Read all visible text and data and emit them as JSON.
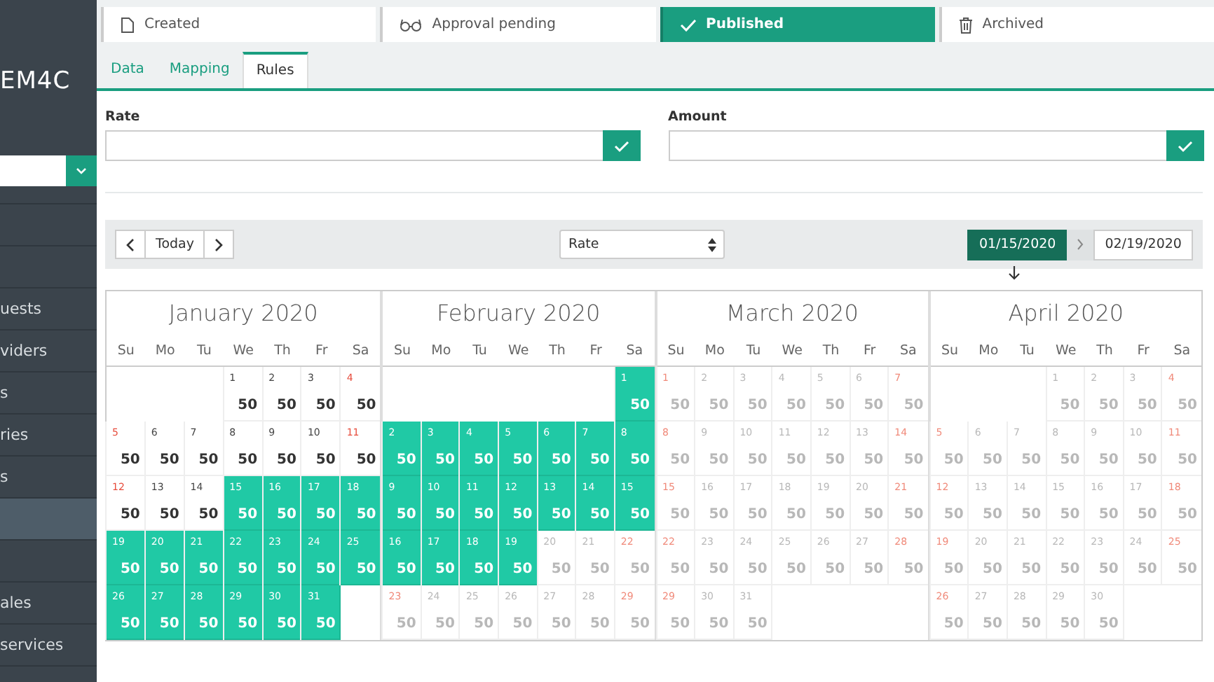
{
  "sidebar": {
    "logo": "EM4C",
    "items": [
      {
        "selected": false
      },
      {
        "selected": false
      },
      {
        "label": "uests",
        "selected": false
      },
      {
        "label": "viders",
        "selected": false
      },
      {
        "label": "s",
        "selected": false
      },
      {
        "label": "ries",
        "selected": false
      },
      {
        "label": "s",
        "selected": false
      },
      {
        "selected": true
      },
      {
        "selected": false
      },
      {
        "label": "ales",
        "selected": false
      },
      {
        "label": "services",
        "selected": false
      }
    ]
  },
  "steps": [
    {
      "label": "Created",
      "selected": false
    },
    {
      "label": "Approval pending",
      "selected": false
    },
    {
      "label": "Published",
      "selected": true
    },
    {
      "label": "Archived",
      "selected": false
    }
  ],
  "tabs": [
    {
      "label": "Data",
      "selected": false
    },
    {
      "label": "Mapping",
      "selected": false
    },
    {
      "label": "Rules",
      "selected": true
    }
  ],
  "fields": [
    {
      "label": "Rate"
    },
    {
      "label": "Amount"
    }
  ],
  "toolbar": {
    "today": "Today",
    "select": "Rate",
    "range": [
      {
        "label": "01/15/2020",
        "selected": true
      },
      {
        "label": "02/19/2020",
        "selected": false
      }
    ]
  },
  "months": [
    {
      "title": "January 2020",
      "weekdays": [
        "Su",
        "Mo",
        "Tu",
        "We",
        "Th",
        "Fr",
        "Sa"
      ],
      "weeks": [
        [
          {
            "day": "1",
            "value": "50",
            "kind": "past"
          },
          {
            "day": "2",
            "value": "50",
            "kind": "past"
          },
          {
            "day": "3",
            "value": "50",
            "kind": "past"
          },
          {
            "day": "4",
            "value": "50",
            "kind": "past"
          }
        ],
        [
          {
            "day": "5",
            "value": "50",
            "kind": "past"
          },
          {
            "day": "6",
            "value": "50",
            "kind": "past"
          },
          {
            "day": "7",
            "value": "50",
            "kind": "past"
          },
          {
            "day": "8",
            "value": "50",
            "kind": "past"
          },
          {
            "day": "9",
            "value": "50",
            "kind": "past"
          },
          {
            "day": "10",
            "value": "50",
            "kind": "past"
          },
          {
            "day": "11",
            "value": "50",
            "kind": "past"
          }
        ],
        [
          {
            "day": "12",
            "value": "50",
            "kind": "past"
          },
          {
            "day": "13",
            "value": "50",
            "kind": "past"
          },
          {
            "day": "14",
            "value": "50",
            "kind": "past"
          },
          {
            "day": "15",
            "value": "50",
            "kind": "selected"
          },
          {
            "day": "16",
            "value": "50",
            "kind": "selected"
          },
          {
            "day": "17",
            "value": "50",
            "kind": "selected"
          },
          {
            "day": "18",
            "value": "50",
            "kind": "selected"
          }
        ],
        [
          {
            "day": "19",
            "value": "50",
            "kind": "selected"
          },
          {
            "day": "20",
            "value": "50",
            "kind": "selected"
          },
          {
            "day": "21",
            "value": "50",
            "kind": "selected"
          },
          {
            "day": "22",
            "value": "50",
            "kind": "selected"
          },
          {
            "day": "23",
            "value": "50",
            "kind": "selected"
          },
          {
            "day": "24",
            "value": "50",
            "kind": "selected"
          },
          {
            "day": "25",
            "value": "50",
            "kind": "selected"
          }
        ],
        [
          {
            "day": "26",
            "value": "50",
            "kind": "selected"
          },
          {
            "day": "27",
            "value": "50",
            "kind": "selected"
          },
          {
            "day": "28",
            "value": "50",
            "kind": "selected"
          },
          {
            "day": "29",
            "value": "50",
            "kind": "selected"
          },
          {
            "day": "30",
            "value": "50",
            "kind": "selected"
          },
          {
            "day": "31",
            "value": "50",
            "kind": "selected"
          }
        ]
      ]
    },
    {
      "title": "February 2020",
      "weekdays": [
        "Su",
        "Mo",
        "Tu",
        "We",
        "Th",
        "Fr",
        "Sa"
      ],
      "weeks": [
        [
          {
            "day": "1",
            "value": "50",
            "kind": "selected"
          }
        ],
        [
          {
            "day": "2",
            "value": "50",
            "kind": "selected"
          },
          {
            "day": "3",
            "value": "50",
            "kind": "selected"
          },
          {
            "day": "4",
            "value": "50",
            "kind": "selected"
          },
          {
            "day": "5",
            "value": "50",
            "kind": "selected"
          },
          {
            "day": "6",
            "value": "50",
            "kind": "selected"
          },
          {
            "day": "7",
            "value": "50",
            "kind": "selected"
          },
          {
            "day": "8",
            "value": "50",
            "kind": "selected"
          }
        ],
        [
          {
            "day": "9",
            "value": "50",
            "kind": "selected"
          },
          {
            "day": "10",
            "value": "50",
            "kind": "selected"
          },
          {
            "day": "11",
            "value": "50",
            "kind": "selected"
          },
          {
            "day": "12",
            "value": "50",
            "kind": "selected"
          },
          {
            "day": "13",
            "value": "50",
            "kind": "selected"
          },
          {
            "day": "14",
            "value": "50",
            "kind": "selected"
          },
          {
            "day": "15",
            "value": "50",
            "kind": "selected"
          }
        ],
        [
          {
            "day": "16",
            "value": "50",
            "kind": "selected"
          },
          {
            "day": "17",
            "value": "50",
            "kind": "selected"
          },
          {
            "day": "18",
            "value": "50",
            "kind": "selected"
          },
          {
            "day": "19",
            "value": "50",
            "kind": "selected"
          },
          {
            "day": "20",
            "value": "50",
            "kind": "future"
          },
          {
            "day": "21",
            "value": "50",
            "kind": "future"
          },
          {
            "day": "22",
            "value": "50",
            "kind": "future"
          }
        ],
        [
          {
            "day": "23",
            "value": "50",
            "kind": "future"
          },
          {
            "day": "24",
            "value": "50",
            "kind": "future"
          },
          {
            "day": "25",
            "value": "50",
            "kind": "future"
          },
          {
            "day": "26",
            "value": "50",
            "kind": "future"
          },
          {
            "day": "27",
            "value": "50",
            "kind": "future"
          },
          {
            "day": "28",
            "value": "50",
            "kind": "future"
          },
          {
            "day": "29",
            "value": "50",
            "kind": "future"
          }
        ]
      ]
    },
    {
      "title": "March 2020",
      "weekdays": [
        "Su",
        "Mo",
        "Tu",
        "We",
        "Th",
        "Fr",
        "Sa"
      ],
      "weeks": [
        [
          {
            "day": "1",
            "value": "50",
            "kind": "future"
          },
          {
            "day": "2",
            "value": "50",
            "kind": "future"
          },
          {
            "day": "3",
            "value": "50",
            "kind": "future"
          },
          {
            "day": "4",
            "value": "50",
            "kind": "future"
          },
          {
            "day": "5",
            "value": "50",
            "kind": "future"
          },
          {
            "day": "6",
            "value": "50",
            "kind": "future"
          },
          {
            "day": "7",
            "value": "50",
            "kind": "future"
          }
        ],
        [
          {
            "day": "8",
            "value": "50",
            "kind": "future"
          },
          {
            "day": "9",
            "value": "50",
            "kind": "future"
          },
          {
            "day": "10",
            "value": "50",
            "kind": "future"
          },
          {
            "day": "11",
            "value": "50",
            "kind": "future"
          },
          {
            "day": "12",
            "value": "50",
            "kind": "future"
          },
          {
            "day": "13",
            "value": "50",
            "kind": "future"
          },
          {
            "day": "14",
            "value": "50",
            "kind": "future"
          }
        ],
        [
          {
            "day": "15",
            "value": "50",
            "kind": "future"
          },
          {
            "day": "16",
            "value": "50",
            "kind": "future"
          },
          {
            "day": "17",
            "value": "50",
            "kind": "future"
          },
          {
            "day": "18",
            "value": "50",
            "kind": "future"
          },
          {
            "day": "19",
            "value": "50",
            "kind": "future"
          },
          {
            "day": "20",
            "value": "50",
            "kind": "future"
          },
          {
            "day": "21",
            "value": "50",
            "kind": "future"
          }
        ],
        [
          {
            "day": "22",
            "value": "50",
            "kind": "future"
          },
          {
            "day": "23",
            "value": "50",
            "kind": "future"
          },
          {
            "day": "24",
            "value": "50",
            "kind": "future"
          },
          {
            "day": "25",
            "value": "50",
            "kind": "future"
          },
          {
            "day": "26",
            "value": "50",
            "kind": "future"
          },
          {
            "day": "27",
            "value": "50",
            "kind": "future"
          },
          {
            "day": "28",
            "value": "50",
            "kind": "future"
          }
        ],
        [
          {
            "day": "29",
            "value": "50",
            "kind": "future"
          },
          {
            "day": "30",
            "value": "50",
            "kind": "future"
          },
          {
            "day": "31",
            "value": "50",
            "kind": "future"
          }
        ]
      ]
    },
    {
      "title": "April 2020",
      "weekdays": [
        "Su",
        "Mo",
        "Tu",
        "We",
        "Th",
        "Fr",
        "Sa"
      ],
      "weeks": [
        [
          {
            "day": "1",
            "value": "50",
            "kind": "future"
          },
          {
            "day": "2",
            "value": "50",
            "kind": "future"
          },
          {
            "day": "3",
            "value": "50",
            "kind": "future"
          },
          {
            "day": "4",
            "value": "50",
            "kind": "future"
          }
        ],
        [
          {
            "day": "5",
            "value": "50",
            "kind": "future"
          },
          {
            "day": "6",
            "value": "50",
            "kind": "future"
          },
          {
            "day": "7",
            "value": "50",
            "kind": "future"
          },
          {
            "day": "8",
            "value": "50",
            "kind": "future"
          },
          {
            "day": "9",
            "value": "50",
            "kind": "future"
          },
          {
            "day": "10",
            "value": "50",
            "kind": "future"
          },
          {
            "day": "11",
            "value": "50",
            "kind": "future"
          }
        ],
        [
          {
            "day": "12",
            "value": "50",
            "kind": "future"
          },
          {
            "day": "13",
            "value": "50",
            "kind": "future"
          },
          {
            "day": "14",
            "value": "50",
            "kind": "future"
          },
          {
            "day": "15",
            "value": "50",
            "kind": "future"
          },
          {
            "day": "16",
            "value": "50",
            "kind": "future"
          },
          {
            "day": "17",
            "value": "50",
            "kind": "future"
          },
          {
            "day": "18",
            "value": "50",
            "kind": "future"
          }
        ],
        [
          {
            "day": "19",
            "value": "50",
            "kind": "future"
          },
          {
            "day": "20",
            "value": "50",
            "kind": "future"
          },
          {
            "day": "21",
            "value": "50",
            "kind": "future"
          },
          {
            "day": "22",
            "value": "50",
            "kind": "future"
          },
          {
            "day": "23",
            "value": "50",
            "kind": "future"
          },
          {
            "day": "24",
            "value": "50",
            "kind": "future"
          },
          {
            "day": "25",
            "value": "50",
            "kind": "future"
          }
        ],
        [
          {
            "day": "26",
            "value": "50",
            "kind": "future"
          },
          {
            "day": "27",
            "value": "50",
            "kind": "future"
          },
          {
            "day": "28",
            "value": "50",
            "kind": "future"
          },
          {
            "day": "29",
            "value": "50",
            "kind": "future"
          },
          {
            "day": "30",
            "value": "50",
            "kind": "future"
          }
        ]
      ]
    }
  ]
}
